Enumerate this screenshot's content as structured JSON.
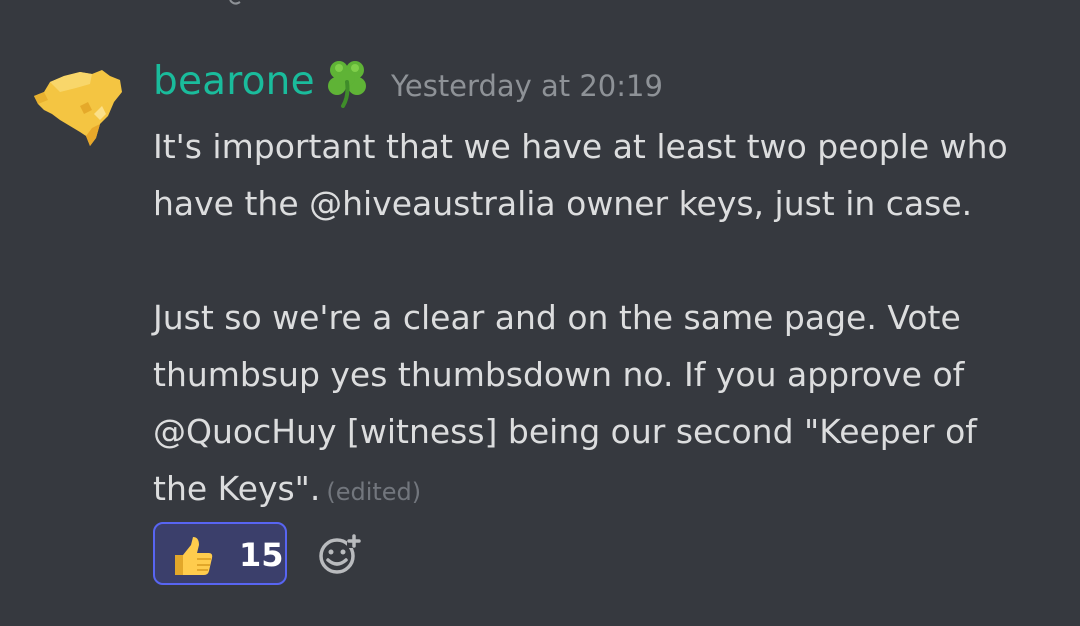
{
  "message": {
    "author": "bearone",
    "author_color": "#1abc9c",
    "author_badge": "clover-icon",
    "timestamp": "Yesterday at 20:19",
    "paragraphs": [
      [
        "It's important that we have at least two people who",
        "have the @hiveaustralia owner keys, just in case."
      ],
      [
        "Just so we're a clear and on the same page. Vote",
        "thumbsup yes thumbsdown no. If you approve of",
        "@QuocHuy [witness] being our second \"Keeper of",
        "the Keys\"."
      ]
    ],
    "edited_label": "(edited)"
  },
  "reactions": [
    {
      "emoji": "thumbs-up-icon",
      "count": "15",
      "selected": true,
      "accent": "#5865f2"
    }
  ],
  "add_reaction_icon": "add-reaction-icon"
}
